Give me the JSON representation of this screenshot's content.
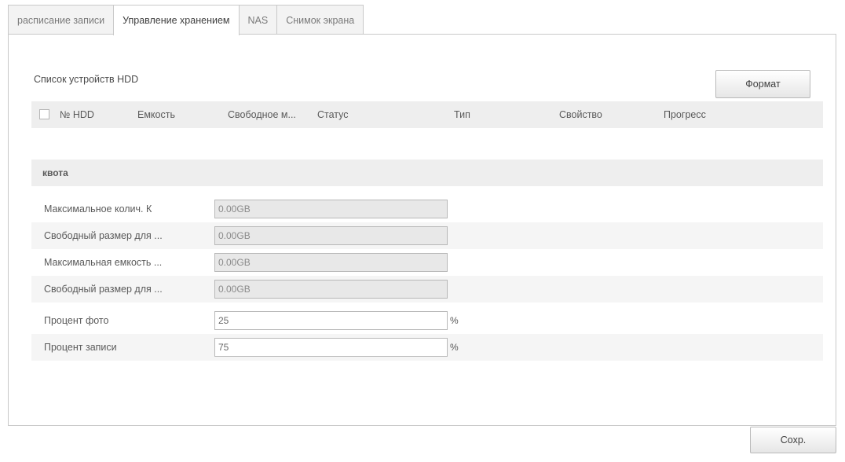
{
  "tabs": [
    {
      "label": "расписание записи",
      "active": false
    },
    {
      "label": "Управление хранением",
      "active": true
    },
    {
      "label": "NAS",
      "active": false
    },
    {
      "label": "Снимок экрана",
      "active": false
    }
  ],
  "hdd": {
    "title": "Список устройств HDD",
    "format_label": "Формат",
    "columns": [
      "№ HDD",
      "Емкость",
      "Свободное м...",
      "Статус",
      "Тип",
      "Свойство",
      "Прогресс"
    ],
    "rows": []
  },
  "quota": {
    "title": "квота",
    "fields": [
      {
        "label": "Максимальное колич. К",
        "value": "0.00GB",
        "readonly": true,
        "unit": ""
      },
      {
        "label": "Свободный размер для ...",
        "value": "0.00GB",
        "readonly": true,
        "unit": ""
      },
      {
        "label": "Максимальная емкость ...",
        "value": "0.00GB",
        "readonly": true,
        "unit": ""
      },
      {
        "label": "Свободный размер для ...",
        "value": "0.00GB",
        "readonly": true,
        "unit": ""
      },
      {
        "label": "Процент фото",
        "value": "25",
        "readonly": false,
        "unit": "%"
      },
      {
        "label": "Процент записи",
        "value": "75",
        "readonly": false,
        "unit": "%"
      }
    ]
  },
  "save_label": "Сохр."
}
